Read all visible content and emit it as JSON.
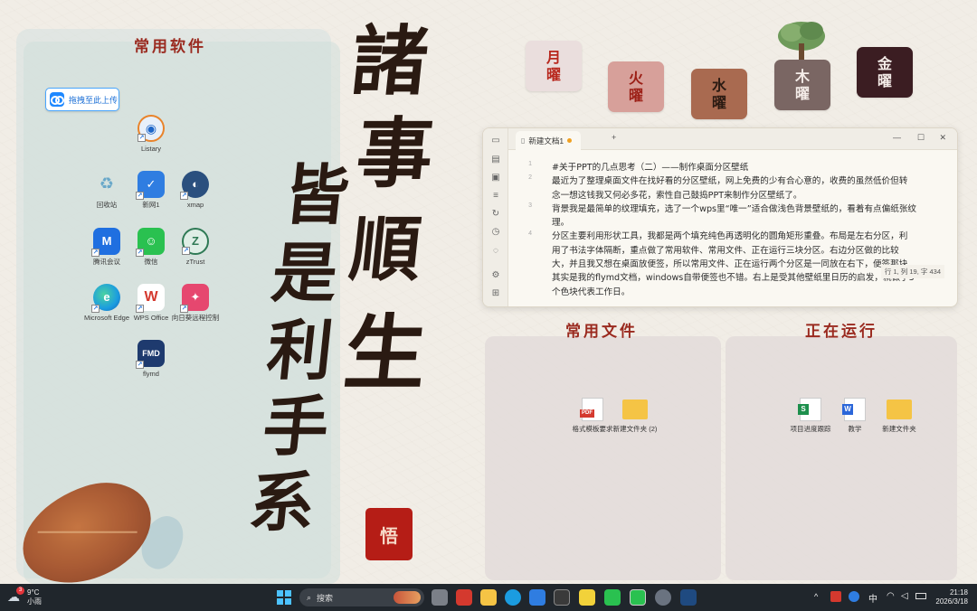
{
  "left_zone": {
    "title": "常用软件",
    "upload_label": "拖拽至此上传",
    "icons": [
      {
        "label": "Listary",
        "icon": "listary-icon",
        "color": "#e8f0fa"
      },
      {
        "label": "回收站",
        "icon": "recycle-bin-icon",
        "color": "#dfe8ee"
      },
      {
        "label": "新网1",
        "icon": "shield-app-icon",
        "color": "#2f7de1"
      },
      {
        "label": "xmap",
        "icon": "globe-app-icon",
        "color": "#2a4f7e"
      },
      {
        "label": "腾讯会议",
        "icon": "meeting-icon",
        "color": "#1f6fe0"
      },
      {
        "label": "微信",
        "icon": "wechat-icon",
        "color": "#2ac150"
      },
      {
        "label": "zTrust",
        "icon": "ztrust-icon",
        "color": "#2f7a55"
      },
      {
        "label": "Microsoft Edge",
        "icon": "edge-icon",
        "color": "#1b9ce0"
      },
      {
        "label": "WPS Office",
        "icon": "wps-icon",
        "color": "#d4392e"
      },
      {
        "label": "向日葵远程控制",
        "icon": "sunlogin-icon",
        "color": "#e6476f"
      },
      {
        "label": "flymd",
        "icon": "flymd-icon",
        "color": "#1e3a6e"
      }
    ]
  },
  "calligraphy": {
    "column1": [
      "諸",
      "事",
      "皆",
      "順",
      "生"
    ],
    "column2": [
      "皆",
      "是",
      "利",
      "手",
      "系"
    ],
    "seal": "悟"
  },
  "weekdays": [
    {
      "top": "月",
      "bottom": "曜",
      "bg": "#eadedd",
      "fg": "#b8271d"
    },
    {
      "top": "火",
      "bottom": "曜",
      "bg": "#d7a09a",
      "fg": "#9c1f16"
    },
    {
      "top": "水",
      "bottom": "曜",
      "bg": "#a96a50",
      "fg": "#2a1a12"
    },
    {
      "top": "木",
      "bottom": "曜",
      "bg": "#7a6663",
      "fg": "#f4ece8"
    },
    {
      "top": "金",
      "bottom": "曜",
      "bg": "#3b1d22",
      "fg": "#f4ece8"
    }
  ],
  "editor": {
    "tab_title": "新建文档1",
    "add_tab": "+",
    "lines": [
      {
        "num": "1",
        "text": "#关于PPT的几点思考（二）——制作桌面分区壁纸"
      },
      {
        "num": "2",
        "text": "最近为了整理桌面文件在找好看的分区壁纸，网上免费的少有合心意的，收费的虽然低价但转"
      },
      {
        "num": "",
        "text": "念一想这钱我又何必多花，索性自己鼓捣PPT来制作分区壁纸了。"
      },
      {
        "num": "3",
        "text": "背景我是最简单的纹理填充，选了一个wps里“唯一”适合做浅色背景壁纸的，看着有点偏纸张纹"
      },
      {
        "num": "",
        "text": "理。"
      },
      {
        "num": "4",
        "text": "分区主要利用形状工具，我都是两个填充纯色再透明化的圆角矩形重叠。布局是左右分区，利"
      },
      {
        "num": "",
        "text": "用了书法字体隔断，重点做了常用软件、常用文件、正在运行三块分区。右边分区做的比较"
      },
      {
        "num": "",
        "text": "大，并且我又想在桌面放便签，所以常用文件、正在运行两个分区是一同放在右下，便签那块"
      },
      {
        "num": "",
        "text": "其实是我的flymd文档，windows自带便签也不错。右上是受其他壁纸里日历的启发，就做了5"
      },
      {
        "num": "",
        "text": "个色块代表工作日。"
      }
    ],
    "status": "行 1, 列 19, 字 434"
  },
  "files_zone": {
    "title": "常用文件",
    "icons": [
      {
        "label": "格式模板要求",
        "icon": "pdf-icon"
      },
      {
        "label": "新建文件夹 (2)",
        "icon": "folder-icon"
      }
    ]
  },
  "running_zone": {
    "title": "正在运行",
    "icons": [
      {
        "label": "项目进度跟踪",
        "icon": "spreadsheet-icon"
      },
      {
        "label": "教学",
        "icon": "word-doc-icon"
      },
      {
        "label": "新建文件夹",
        "icon": "folder-icon"
      }
    ]
  },
  "taskbar": {
    "weather_temp": "9°C",
    "weather_desc": "小雨",
    "weather_badge": "3",
    "search_placeholder": "搜索",
    "ime": "中",
    "time": "21:18",
    "date": "2026/3/18"
  }
}
